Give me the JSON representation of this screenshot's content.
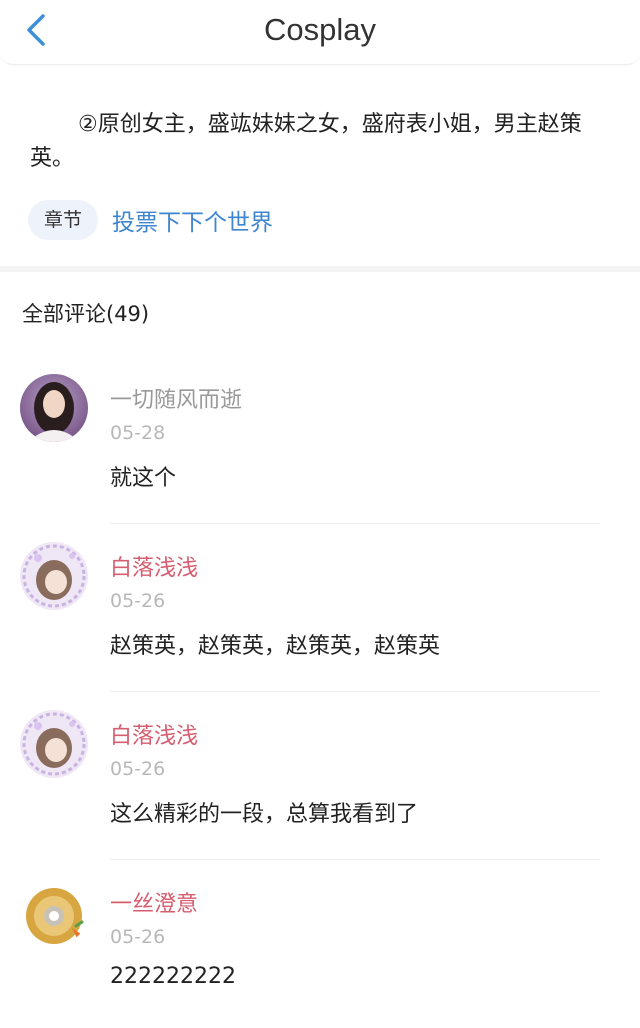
{
  "header": {
    "title": "Cosplay",
    "back_icon": "chevron-left-icon",
    "back_color": "#3d8fd9"
  },
  "description": "②原创女主，盛竑妹妹之女，盛府表小姐，男主赵策英。",
  "chapter": {
    "tag": "章节",
    "link": "投票下下个世界",
    "link_color": "#3f86d0"
  },
  "comments_header": "全部评论(49)",
  "comments": [
    {
      "username": "一切随风而逝",
      "username_color": "#999999",
      "date": "05-28",
      "text": "就这个",
      "avatar": "user-photo-avatar"
    },
    {
      "username": "白落浅浅",
      "username_color": "#d55d6e",
      "date": "05-26",
      "text": "赵策英，赵策英，赵策英，赵策英",
      "avatar": "anime-girl-avatar"
    },
    {
      "username": "白落浅浅",
      "username_color": "#d55d6e",
      "date": "05-26",
      "text": "这么精彩的一段，总算我看到了",
      "avatar": "anime-girl-avatar"
    },
    {
      "username": "一丝澄意",
      "username_color": "#d55d6e",
      "date": "05-26",
      "text": "222222222",
      "avatar": "bunny-avatar"
    }
  ]
}
